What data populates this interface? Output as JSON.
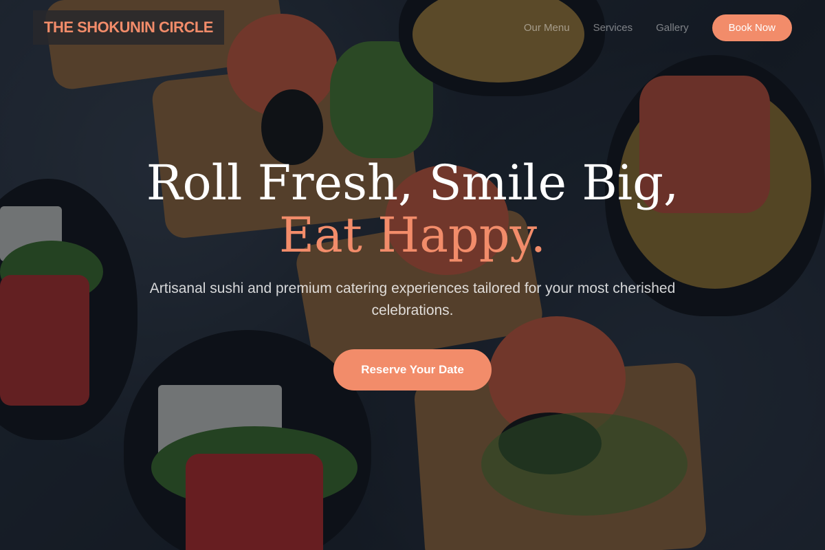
{
  "brand": {
    "name": "THE SHOKUNIN CIRCLE",
    "accent_color": "#f28c6a"
  },
  "nav": {
    "links": [
      "Our Menu",
      "Services",
      "Gallery"
    ],
    "cta_label": "Book Now"
  },
  "hero": {
    "title_main": "Roll Fresh, Smile Big, ",
    "title_accent": "Eat Happy.",
    "subtitle": "Artisanal sushi and premium catering experiences tailored for your most cherished celebrations.",
    "cta_label": "Reserve Your Date"
  }
}
